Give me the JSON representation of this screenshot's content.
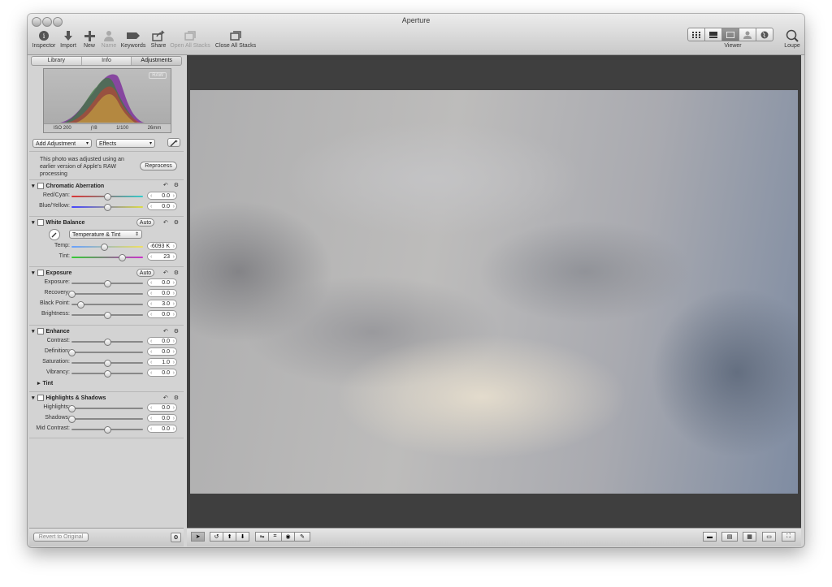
{
  "window": {
    "title": "Aperture"
  },
  "toolbar": {
    "inspector": "Inspector",
    "import": "Import",
    "new": "New",
    "name": "Name",
    "keywords": "Keywords",
    "share": "Share",
    "open_stacks": "Open All Stacks",
    "close_stacks": "Close All Stacks",
    "viewer": "Viewer",
    "loupe": "Loupe"
  },
  "tabs": [
    "Library",
    "Info",
    "Adjustments"
  ],
  "histogram": {
    "badge": "RAW",
    "iso": "ISO 200",
    "aperture": "ƒ/8",
    "shutter": "1/100",
    "focal": "26mm"
  },
  "controls": {
    "add_adjustment": "Add Adjustment",
    "effects": "Effects"
  },
  "notice": {
    "text": "This photo was adjusted using an earlier version of Apple's RAW processing",
    "button": "Reprocess"
  },
  "chromatic": {
    "title": "Chromatic Aberration",
    "rows": [
      {
        "label": "Red/Cyan:",
        "value": "0.0",
        "pos": 0.5
      },
      {
        "label": "Blue/Yellow:",
        "value": "0.0",
        "pos": 0.5
      }
    ]
  },
  "white_balance": {
    "title": "White Balance",
    "auto": "Auto",
    "mode": "Temperature & Tint",
    "rows": [
      {
        "label": "Temp:",
        "value": "6093 K",
        "pos": 0.45
      },
      {
        "label": "Tint:",
        "value": "23",
        "pos": 0.7
      }
    ]
  },
  "exposure": {
    "title": "Exposure",
    "auto": "Auto",
    "rows": [
      {
        "label": "Exposure:",
        "value": "0.0",
        "pos": 0.5
      },
      {
        "label": "Recovery:",
        "value": "0.0",
        "pos": 0.0
      },
      {
        "label": "Black Point:",
        "value": "3.0",
        "pos": 0.12
      },
      {
        "label": "Brightness:",
        "value": "0.0",
        "pos": 0.5
      }
    ]
  },
  "enhance": {
    "title": "Enhance",
    "tint_label": "Tint",
    "rows": [
      {
        "label": "Contrast:",
        "value": "0.0",
        "pos": 0.5
      },
      {
        "label": "Definition:",
        "value": "0.0",
        "pos": 0.0
      },
      {
        "label": "Saturation:",
        "value": "1.0",
        "pos": 0.5
      },
      {
        "label": "Vibrancy:",
        "value": "0.0",
        "pos": 0.5
      }
    ]
  },
  "highlights": {
    "title": "Highlights & Shadows",
    "rows": [
      {
        "label": "Highlights:",
        "value": "0.0",
        "pos": 0.0
      },
      {
        "label": "Shadows:",
        "value": "0.0",
        "pos": 0.0
      },
      {
        "label": "Mid Contrast:",
        "value": "0.0",
        "pos": 0.5
      }
    ]
  },
  "footer": {
    "revert": "Revert to Original"
  }
}
